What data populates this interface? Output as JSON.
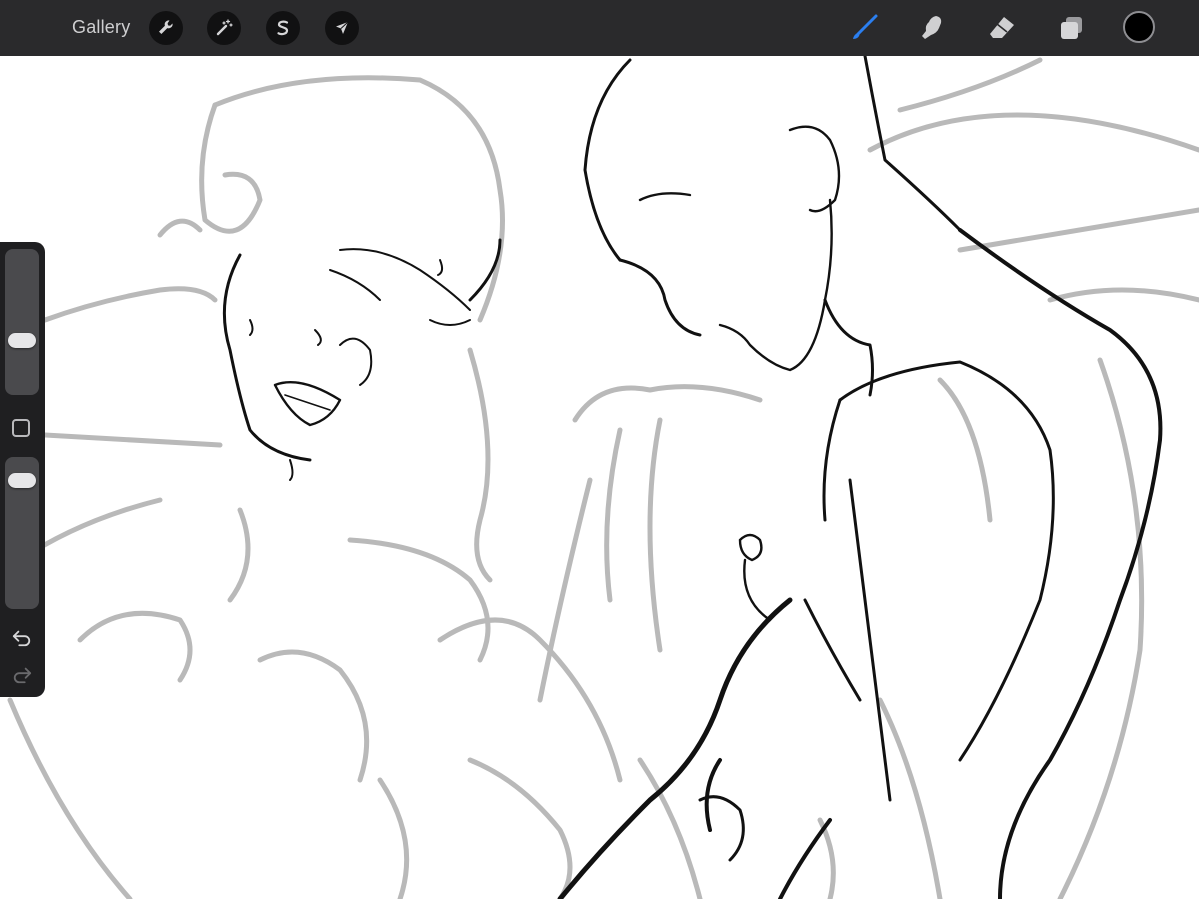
{
  "toolbar": {
    "gallery_label": "Gallery",
    "left_tools": [
      {
        "name": "actions",
        "icon": "wrench-icon"
      },
      {
        "name": "adjustments",
        "icon": "magic-wand-icon"
      },
      {
        "name": "selection",
        "icon": "selection-s-icon"
      },
      {
        "name": "transform",
        "icon": "arrow-cursor-icon"
      }
    ],
    "right_tools": [
      {
        "name": "brush",
        "icon": "brush-icon",
        "active": true
      },
      {
        "name": "smudge",
        "icon": "smudge-finger-icon"
      },
      {
        "name": "eraser",
        "icon": "eraser-icon"
      },
      {
        "name": "layers",
        "icon": "layers-icon"
      }
    ],
    "current_color": "#000000",
    "accent_color": "#2b7ff0"
  },
  "sidebar": {
    "brush_size_level": 0.35,
    "opacity_level": 0.9,
    "controls": [
      "brush-size-slider",
      "modify-button",
      "opacity-slider",
      "undo-button",
      "redo-button"
    ]
  }
}
